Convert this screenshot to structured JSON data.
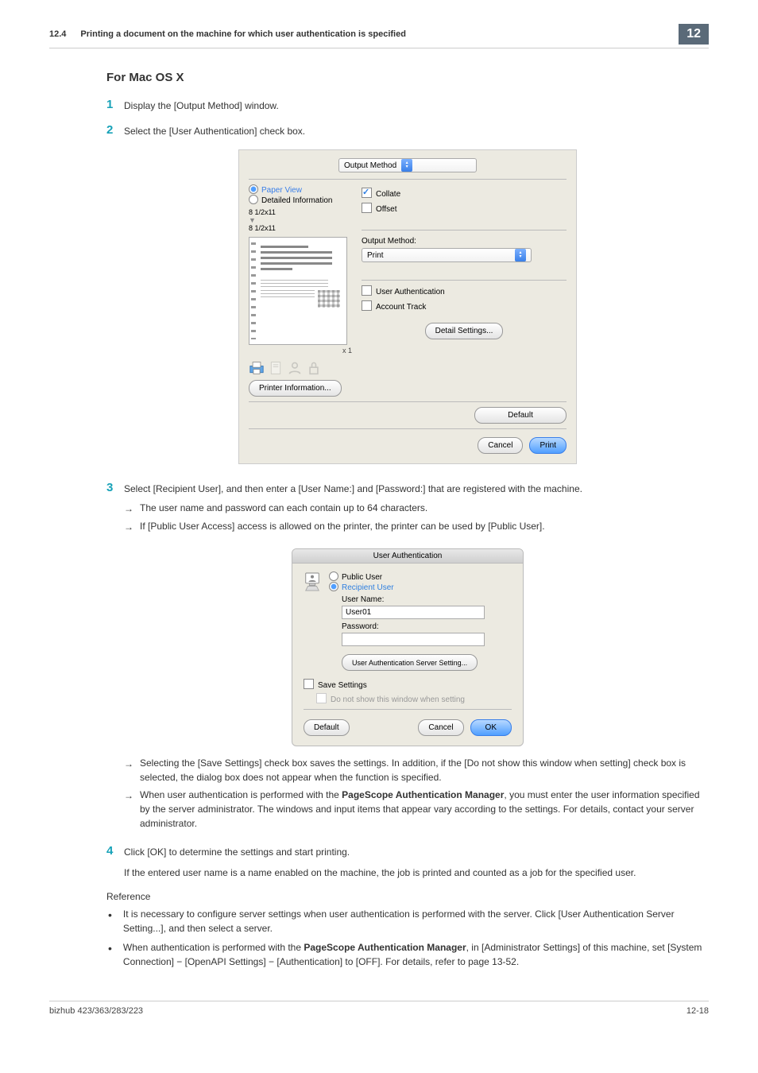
{
  "header": {
    "section_number": "12.4",
    "section_title": "Printing a document on the machine for which user authentication is specified",
    "chapter_number": "12"
  },
  "subhead": "For Mac OS X",
  "steps": {
    "s1": {
      "num": "1",
      "text": "Display the [Output Method] window."
    },
    "s2": {
      "num": "2",
      "text": "Select the [User Authentication] check box."
    },
    "s3": {
      "num": "3",
      "text": "Select [Recipient User], and then enter a [User Name:] and [Password:] that are registered with the machine.",
      "arrows1": [
        "The user name and password can each contain up to 64 characters.",
        "If [Public User Access] access is allowed on the printer, the printer can be used by [Public User]."
      ],
      "arrows2": [
        "Selecting the [Save Settings] check box saves the settings. In addition, if the [Do not show this window when setting] check box is selected, the dialog box does not appear when the function is specified.",
        "When user authentication is performed with the PageScope Authentication Manager, you must enter the user information specified by the server administrator. The windows and input items that appear vary according to the settings. For details, contact your server administrator."
      ]
    },
    "s4": {
      "num": "4",
      "text": "Click [OK] to determine the settings and start printing.",
      "extra": "If the entered user name is a name enabled on the machine, the job is printed and counted as a job for the specified user."
    }
  },
  "reference": {
    "head": "Reference",
    "items": [
      "It is necessary to configure server settings when user authentication is performed with the server. Click [User Authentication Server Setting...], and then select a server.",
      "When authentication is performed with the PageScope Authentication Manager, in [Administrator Settings] of this machine, set [System Connection] − [OpenAPI Settings] − [Authentication] to [OFF]. For details, refer to page 13-52."
    ]
  },
  "dialog1": {
    "tab": "Output Method",
    "paper_view": "Paper View",
    "detailed": "Detailed Information",
    "size": "8 1/2x11",
    "copies": "x 1",
    "printer_info": "Printer Information...",
    "collate": "Collate",
    "offset": "Offset",
    "output_label": "Output Method:",
    "output_value": "Print",
    "userauth": "User Authentication",
    "account": "Account Track",
    "detail_settings": "Detail Settings...",
    "default": "Default",
    "cancel": "Cancel",
    "print": "Print"
  },
  "dialog2": {
    "title": "User Authentication",
    "public_user": "Public User",
    "recipient": "Recipient User",
    "username_lbl": "User Name:",
    "username_val": "User01",
    "password_lbl": "Password:",
    "server_btn": "User Authentication Server Setting...",
    "save": "Save Settings",
    "noshow": "Do not show this window when setting",
    "default": "Default",
    "cancel": "Cancel",
    "ok": "OK"
  },
  "footer": {
    "model": "bizhub 423/363/283/223",
    "page": "12-18"
  }
}
